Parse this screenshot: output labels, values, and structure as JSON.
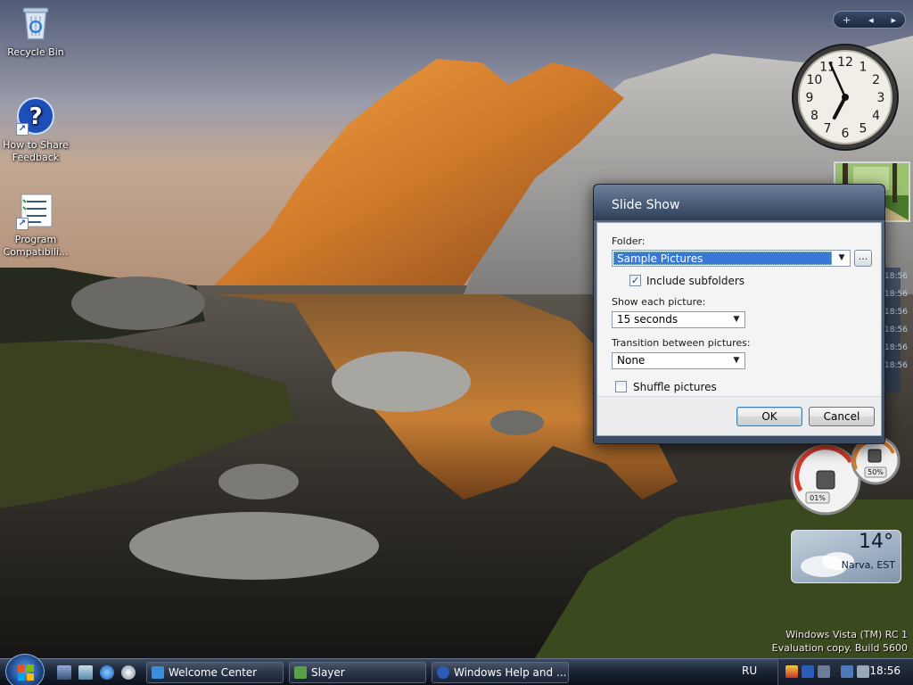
{
  "desktop_icons": [
    {
      "label": "Recycle Bin",
      "icon": "recycle-bin-icon"
    },
    {
      "label": "How to Share Feedback",
      "icon": "help-icon"
    },
    {
      "label": "Program Compatibili...",
      "icon": "program-compatibility-icon"
    }
  ],
  "clock": {
    "numerals": [
      "12",
      "1",
      "2",
      "3",
      "4",
      "5",
      "6",
      "7",
      "8",
      "9",
      "10",
      "11"
    ],
    "hour": 6,
    "minute": 56
  },
  "meter": {
    "cpu_label": "01%",
    "ram_label": "50%"
  },
  "weather": {
    "temp": "14°",
    "city": "Narva, EST"
  },
  "watermark": {
    "line1": "Windows Vista (TM) RC 1",
    "line2": "Evaluation copy. Build 5600"
  },
  "dialog": {
    "title": "Slide Show",
    "folder_label": "Folder:",
    "folder_value": "Sample Pictures",
    "browse_label": "...",
    "include_subfolders_label": "Include subfolders",
    "include_subfolders_checked": true,
    "show_each_label": "Show each picture:",
    "show_each_value": "15 seconds",
    "transition_label": "Transition between pictures:",
    "transition_value": "None",
    "shuffle_label": "Shuffle pictures",
    "shuffle_checked": false,
    "ok_label": "OK",
    "cancel_label": "Cancel"
  },
  "taskbar": {
    "tasks": [
      {
        "label": "Welcome Center",
        "icon": "welcome-center-icon"
      },
      {
        "label": "Slayer",
        "icon": "media-player-icon"
      },
      {
        "label": "Windows Help and ...",
        "icon": "help-icon"
      }
    ],
    "language": "RU",
    "time": "18:56"
  },
  "colors": {
    "accent": "#3a78d8",
    "taskbar": "#1b2535",
    "dialog_frame": "#4a5d78"
  }
}
